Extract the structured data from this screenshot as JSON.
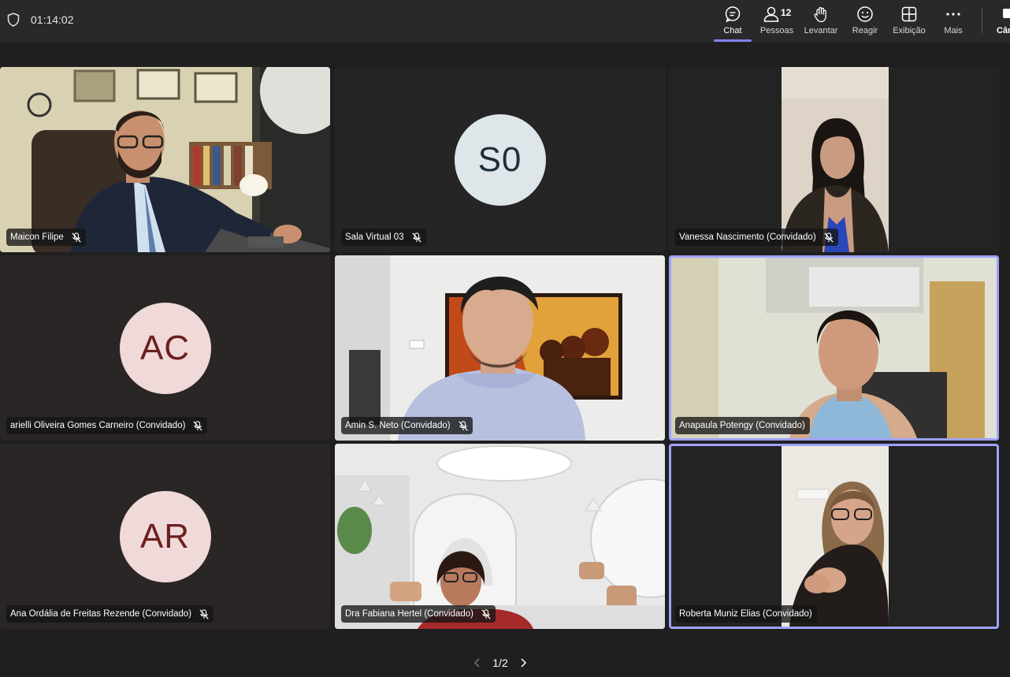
{
  "meeting": {
    "elapsed": "01:14:02"
  },
  "toolbar": {
    "chat": "Chat",
    "people": "Pessoas",
    "people_count": "12",
    "raise": "Levantar",
    "react": "Reagir",
    "view": "Exibição",
    "more": "Mais",
    "camera": "Câm"
  },
  "participants": [
    {
      "name": "Maicon Filipe",
      "muted": true,
      "video": true
    },
    {
      "name": "Sala Virtual 03",
      "initials": "S0",
      "muted": true,
      "video": false
    },
    {
      "name": "Vanessa Nascimento (Convidado)",
      "muted": true,
      "video": true
    },
    {
      "name": "arielli Oliveira Gomes Carneiro (Convidado)",
      "initials": "AC",
      "muted": true,
      "video": false
    },
    {
      "name": "Amin S. Neto (Convidado)",
      "muted": true,
      "video": true
    },
    {
      "name": "Anapaula Potengy (Convidado)",
      "muted": false,
      "video": true,
      "speaking": true
    },
    {
      "name": "Ana Ordália de Freitas Rezende (Convidado)",
      "initials": "AR",
      "muted": true,
      "video": false
    },
    {
      "name": "Dra Fabiana Hertel (Convidado)",
      "muted": true,
      "video": true
    },
    {
      "name": "Roberta Muniz Elias (Convidado)",
      "muted": false,
      "video": true,
      "speaking": true
    }
  ],
  "pagination": {
    "label": "1/2"
  },
  "colors": {
    "accent": "#7f85f5",
    "speaking_border": "#9ea2ff",
    "avatar_dark": "#dfe6ea",
    "avatar_pink": "#f0d9d9",
    "avatar_text_maroon": "#6b1f1f"
  }
}
